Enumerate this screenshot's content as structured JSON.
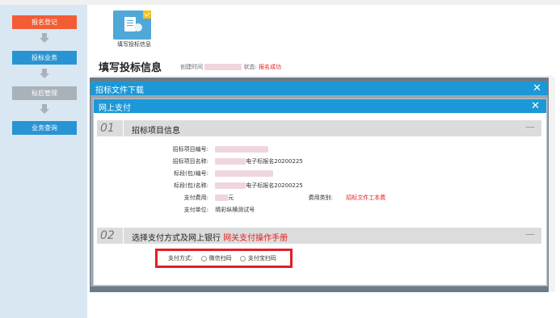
{
  "sidebar": {
    "steps": [
      {
        "label": "报名登记",
        "color": "#f35c35"
      },
      {
        "label": "投标业务",
        "color": "#2994d3"
      },
      {
        "label": "标后管理",
        "color": "#a9b1b9"
      },
      {
        "label": "业务查询",
        "color": "#2994d3"
      }
    ]
  },
  "toolbar": {
    "fill_info_label": "填写投标信息"
  },
  "header": {
    "title": "填写投标信息",
    "created_label": "创建时间",
    "status_label": "状态:",
    "status_value": "报名成功"
  },
  "dialog_download": {
    "title": "招标文件下载",
    "close": "✕"
  },
  "dialog_pay": {
    "title": "网上支付",
    "close": "✕",
    "section1": {
      "num": "01",
      "title": "招标项目信息",
      "min": "—",
      "rows": [
        {
          "label": "招标项目编号:",
          "value": ""
        },
        {
          "label": "招标项目名称:",
          "value": "电子标报名20200225"
        },
        {
          "label": "标段(包)编号:",
          "value": ""
        },
        {
          "label": "标段(包)名称:",
          "value": "电子标报名20200225"
        },
        {
          "label": "支付费用:",
          "value": "元"
        },
        {
          "label": "支付单位:",
          "value": "晴彩纵横测试号"
        }
      ],
      "fee_type_label": "费用类别:",
      "fee_type_value": "招标文件工本费"
    },
    "section2": {
      "num": "02",
      "title": "选择支付方式及网上银行",
      "link": "网关支付操作手册",
      "min": "—",
      "pay_method_label": "支付方式:",
      "options": [
        "微信扫码",
        "支付宝扫码"
      ]
    }
  },
  "colors": {
    "accent": "#1d98d6",
    "status_red": "#e02020",
    "highlight_border": "#e11f26"
  }
}
